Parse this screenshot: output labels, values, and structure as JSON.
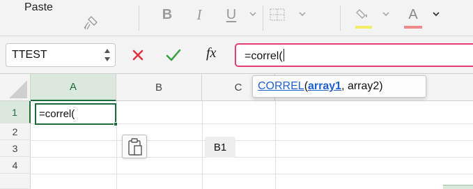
{
  "ribbon": {
    "paste_label": "Paste",
    "bold_label": "B",
    "italic_label": "I",
    "underline_label": "U",
    "font_color_label": "A",
    "fill_color": "#f5ec6a",
    "font_color": "#f08a8a"
  },
  "formula_bar": {
    "name_box_value": "TTEST",
    "fx_label": "fx",
    "formula_value": "=correl("
  },
  "grid": {
    "columns": [
      "A",
      "B",
      "C"
    ],
    "rows": [
      "1",
      "2",
      "3",
      "4"
    ],
    "cells": {
      "A1": "=correl("
    }
  },
  "function_tooltip": {
    "function_name": "CORREL",
    "open_paren": "(",
    "arg1": "array1",
    "rest": ", array2)"
  },
  "cell_reference_tip": "B1",
  "colors": {
    "accent_green": "#1d6b39",
    "formula_border": "#e53e77",
    "link_blue": "#1f5fd6"
  }
}
